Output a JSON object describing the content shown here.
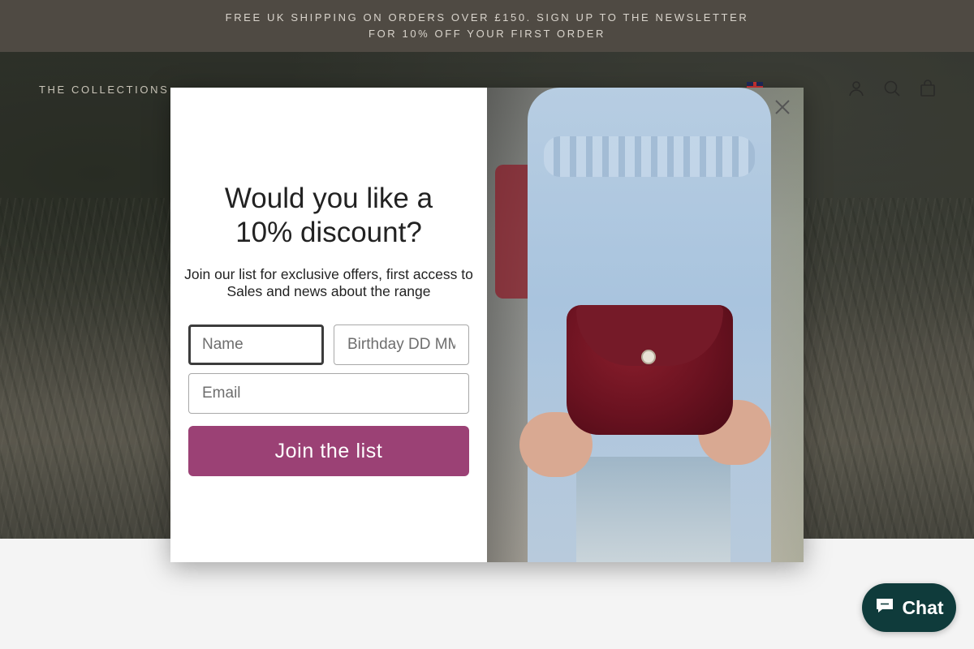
{
  "announcement": {
    "line1": "FREE UK SHIPPING ON ORDERS OVER £150. SIGN UP TO THE NEWSLETTER",
    "line2": "FOR 10% OFF YOUR FIRST ORDER"
  },
  "header": {
    "collections_label": "THE COLLECTIONS",
    "icons": [
      "flag-uk-icon",
      "account-icon",
      "search-icon",
      "cart-icon"
    ]
  },
  "popup": {
    "headline_line1": "Would you like a",
    "headline_line2": "10% discount?",
    "subtext": "Join our list for exclusive offers, first access to Sales and news about the range",
    "name_placeholder": "Name",
    "birthday_placeholder": "Birthday DD MM",
    "email_placeholder": "Email",
    "join_label": "Join the list",
    "accent_color": "#9b4175"
  },
  "chat": {
    "label": "Chat",
    "color": "#0f3b3b"
  }
}
